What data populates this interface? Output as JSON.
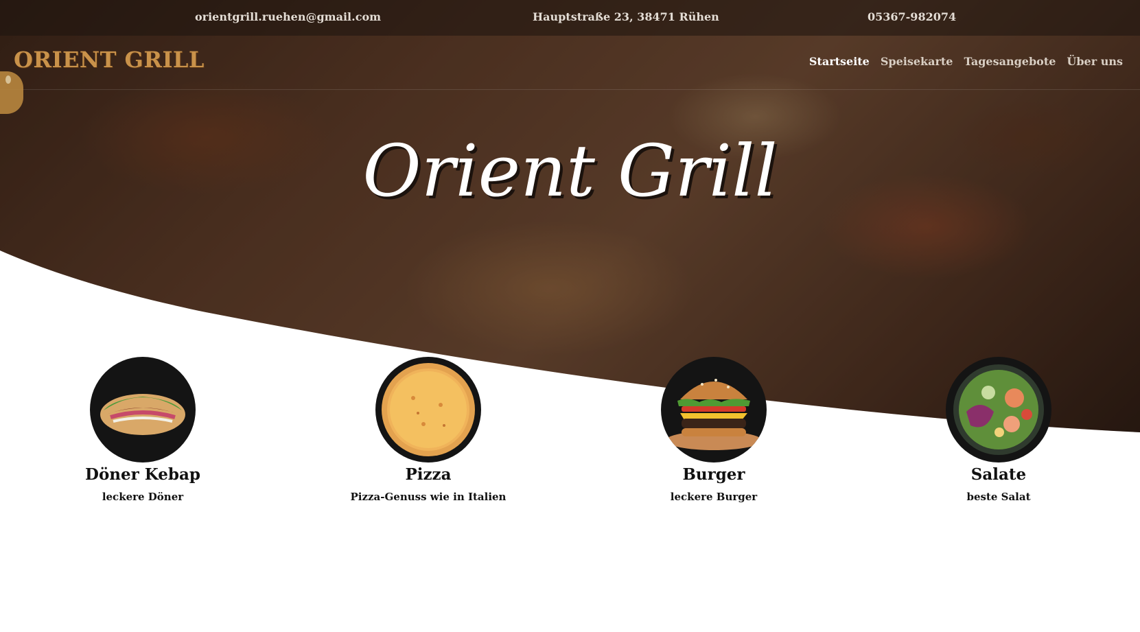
{
  "topbar": {
    "email": "orientgrill.ruehen@gmail.com",
    "address": "Hauptstraße 23, 38471 Rühen",
    "phone": "05367-982074"
  },
  "header": {
    "logo_text": "ORIENT GRILL",
    "nav": [
      {
        "label": "Startseite",
        "active": true
      },
      {
        "label": "Speisekarte",
        "active": false
      },
      {
        "label": "Tagesangebote",
        "active": false
      },
      {
        "label": "Über uns",
        "active": false
      }
    ]
  },
  "hero": {
    "title": "Orient Grill"
  },
  "features": [
    {
      "title": "Döner Kebap",
      "subtitle": "leckere Döner",
      "image": "doener-image"
    },
    {
      "title": "Pizza",
      "subtitle": "Pizza-Genuss wie in Italien",
      "image": "pizza-image"
    },
    {
      "title": "Burger",
      "subtitle": "leckere Burger",
      "image": "burger-image"
    },
    {
      "title": "Salate",
      "subtitle": "beste Salat",
      "image": "salad-image"
    }
  ],
  "colors": {
    "logo": "#c9924a",
    "nav_active": "#ffffff",
    "nav_inactive": "#d9cfc4",
    "text_dark": "#111111"
  }
}
